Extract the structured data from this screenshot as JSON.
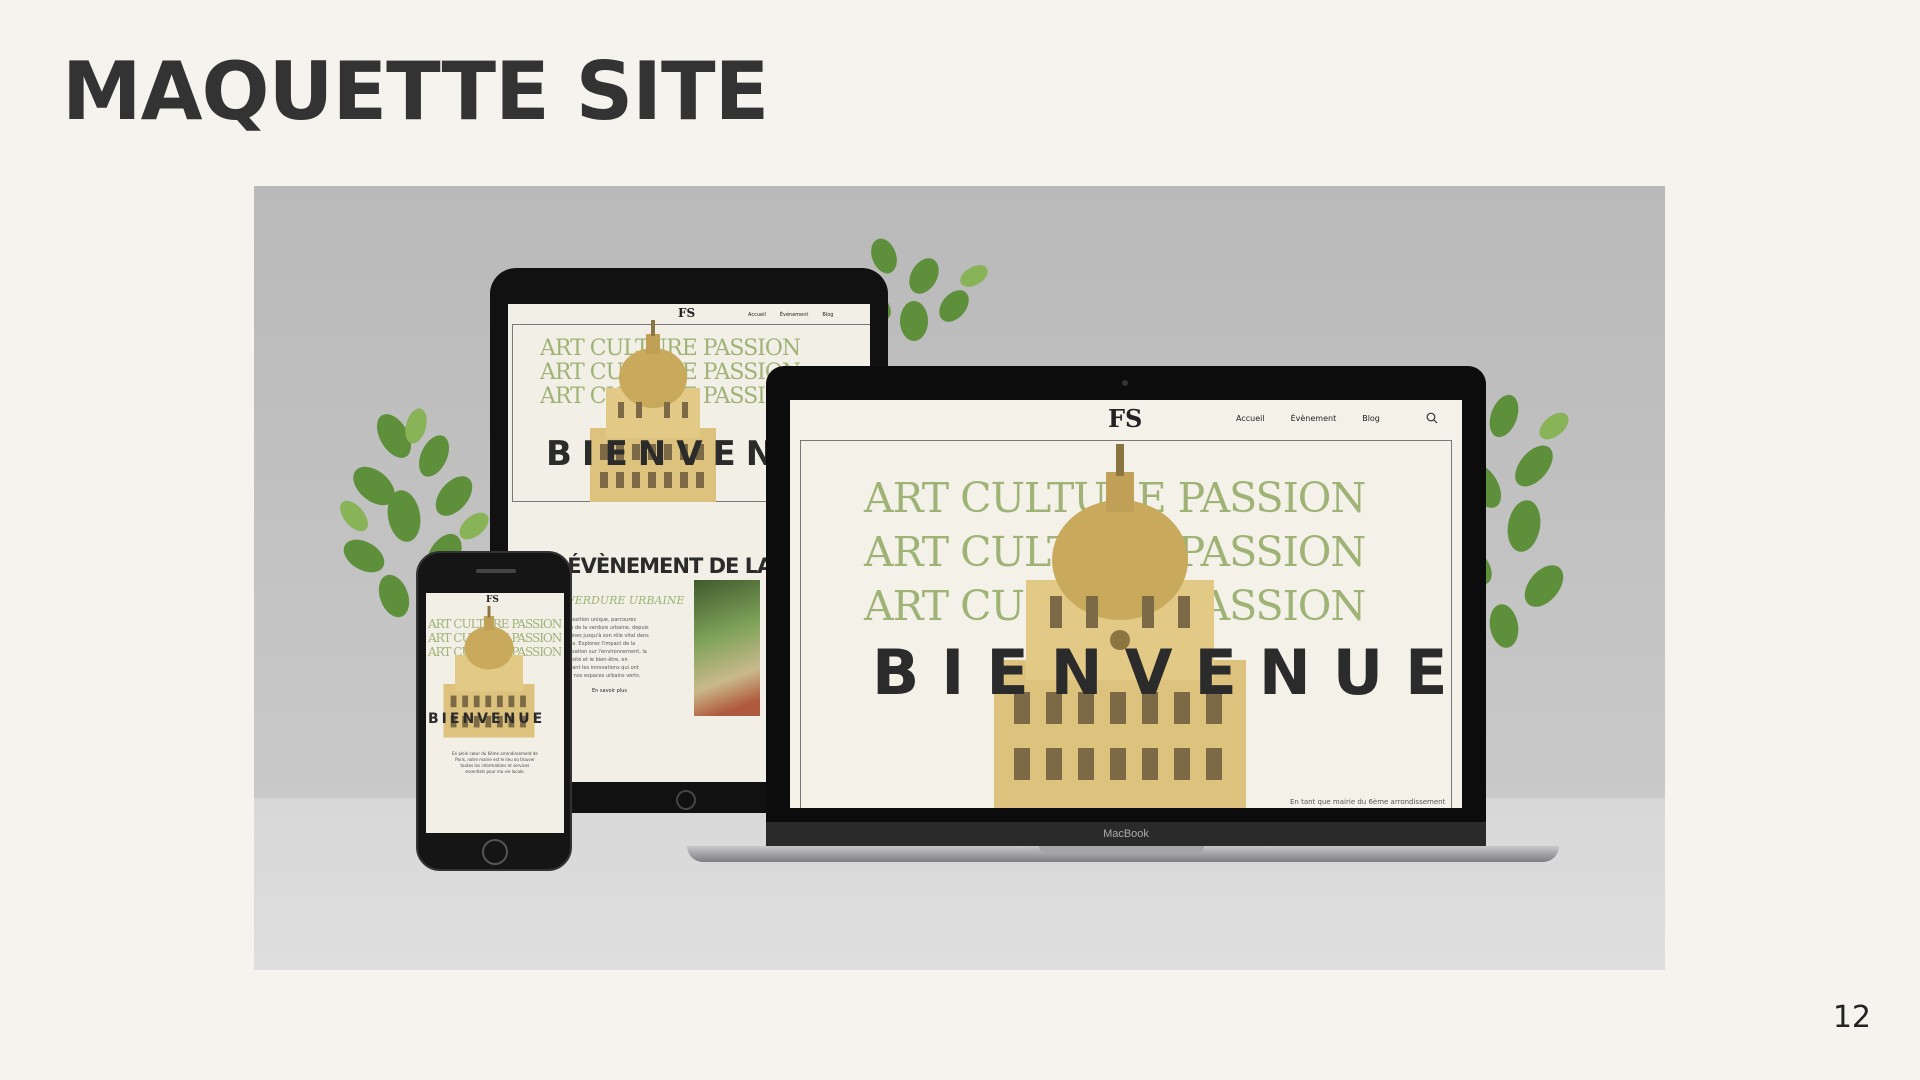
{
  "slide": {
    "title": "MAQUETTE SITE",
    "page_number": "12"
  },
  "site": {
    "logo": "FS",
    "nav": [
      "Accueil",
      "Évènement",
      "Blog"
    ],
    "hero_line": "ART CULTURE PASSION",
    "welcome": "BIENVENUE"
  },
  "tablet": {
    "hero_line": "ART CULTURE PASSION",
    "welcome": "BIENVENUE",
    "event_heading": "ÉVÈNEMENT DE LA SEMAINE",
    "event_subtitle": "LA VERDURE URBAINE",
    "event_text": "Une exposition unique, parcourez l'histoire de la verdure urbaine, depuis ses origines jusqu'à son rôle vital dans nos villes. Explorez l'impact de la végétalisation sur l'environnement, la biodiversité et le bien-être, en découvrant les innovations qui ont façonné nos espaces urbains verts.",
    "read_more": "En savoir plus"
  },
  "phone": {
    "intro_text": "En plein cœur du 6ème arrondissement de Paris, notre mairie est le lieu où trouver toutes les informations et services essentiels pour ma vie locale."
  },
  "laptop": {
    "brand": "MacBook",
    "footer_text": "En tant que mairie du 6ème arrondissement"
  },
  "colors": {
    "background": "#f5f3ee",
    "hero_green": "#9fb377",
    "text_dark": "#2b2b2b"
  }
}
